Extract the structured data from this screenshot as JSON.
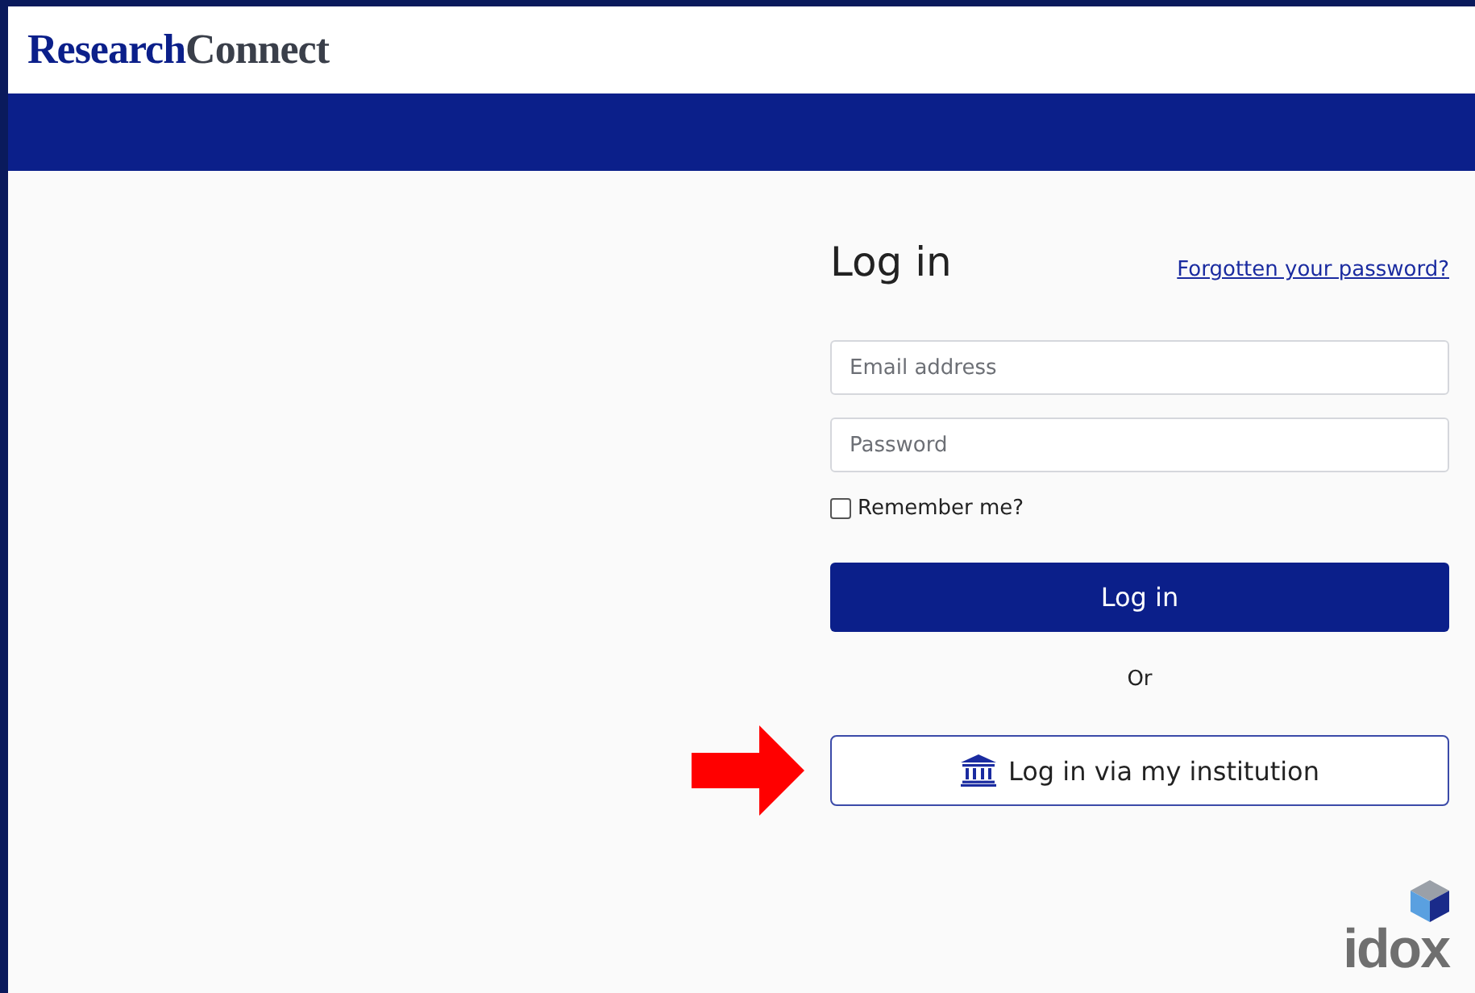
{
  "header": {
    "logo": {
      "first": "Research",
      "second": "Connect"
    }
  },
  "login": {
    "title": "Log in",
    "forgot_link": "Forgotten your password?",
    "email": {
      "placeholder": "Email address"
    },
    "password": {
      "placeholder": "Password"
    },
    "remember": {
      "label": "Remember me?",
      "checked": false
    },
    "submit": "Log in",
    "separator": "Or",
    "institution_button": "Log in via my institution"
  },
  "footer": {
    "brand": "idox"
  }
}
